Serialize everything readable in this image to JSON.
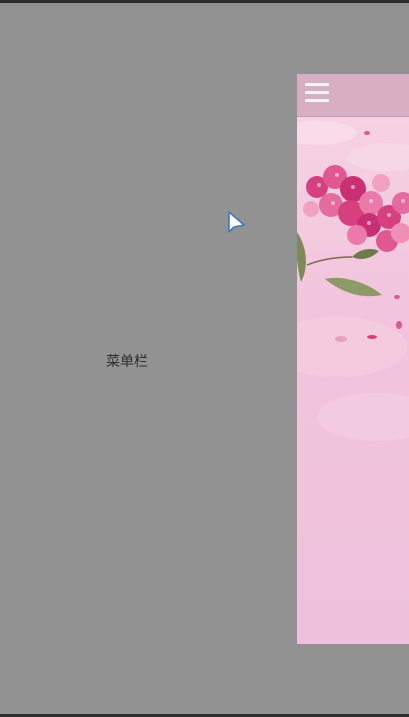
{
  "drawer": {
    "label": "菜单栏"
  },
  "toolbar": {
    "menu_icon": "hamburger-menu-icon"
  },
  "banner": {
    "image": "pink-flower-illustration"
  },
  "colors": {
    "backdrop": "#929292",
    "toolbar": "#d7aec2",
    "content_background": "#f0c2dd",
    "flower_primary": "#d6407f"
  }
}
